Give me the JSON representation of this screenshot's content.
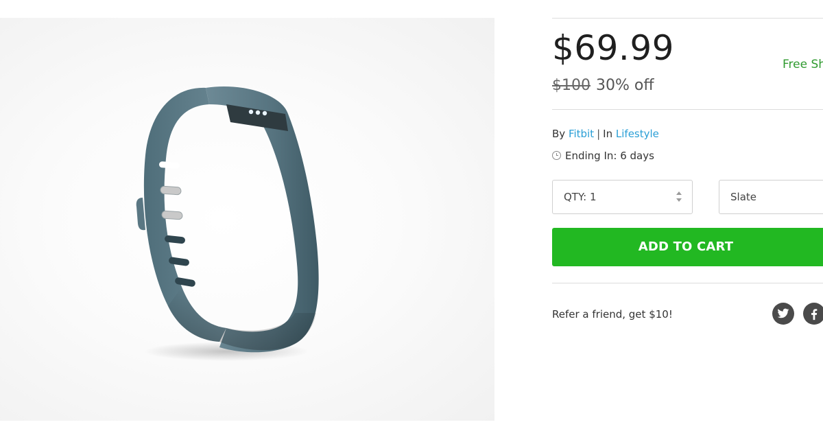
{
  "product": {
    "image_alt": "Fitbit Flex wristband",
    "price": "$69.99",
    "original_price": "$100",
    "discount": "30% off",
    "shipping": "Free Sh"
  },
  "meta": {
    "by_label": "By",
    "brand": "Fitbit",
    "in_label": "In",
    "category": "Lifestyle",
    "ending_label": "Ending In: 6 days"
  },
  "options": {
    "quantity_label": "QTY: 1",
    "variant_label": "Slate"
  },
  "actions": {
    "add_to_cart_label": "ADD TO CART"
  },
  "share": {
    "refer_text": "Refer a friend, get $10!",
    "icons": [
      "twitter-icon",
      "facebook-icon"
    ]
  },
  "colors": {
    "accent_green": "#22b822",
    "shipping_green": "#2f9a2f",
    "link_blue": "#2a9fd6",
    "band_color": "#4f6f7c"
  }
}
